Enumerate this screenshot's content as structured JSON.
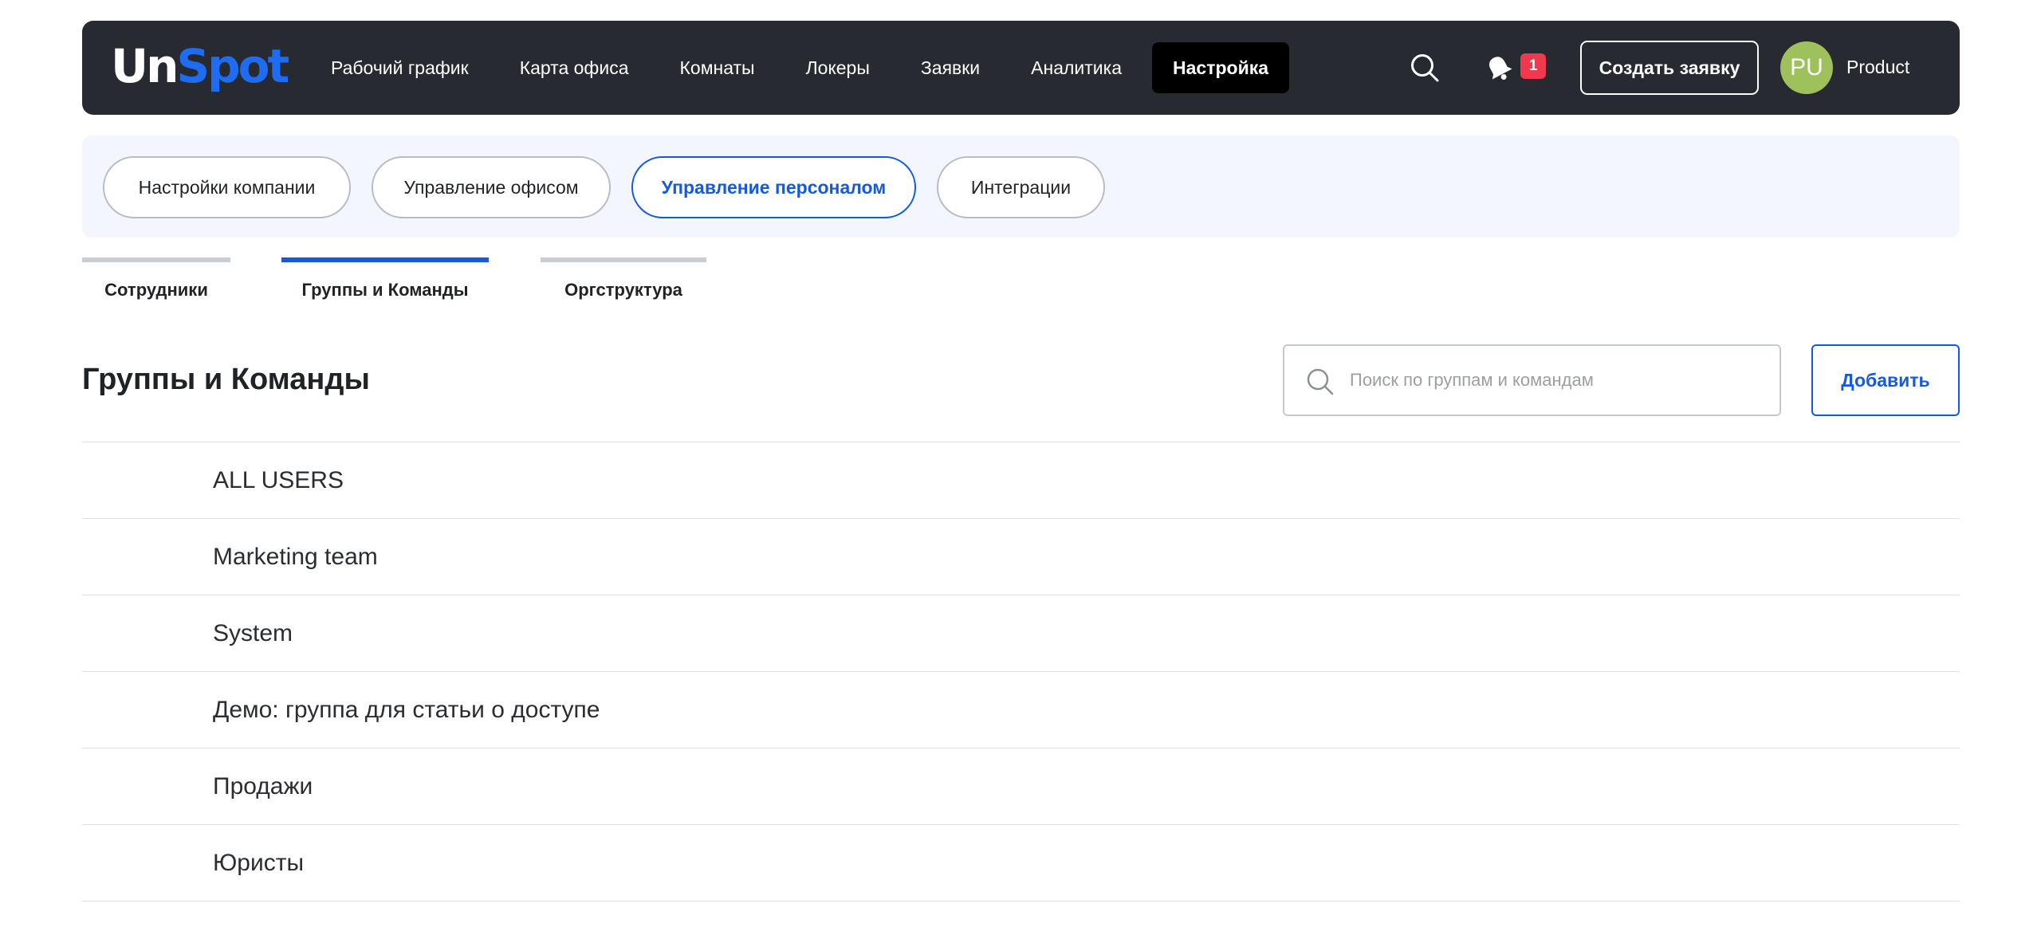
{
  "app": {
    "logo_part1": "Un",
    "logo_part2": "Spot"
  },
  "nav": {
    "items": [
      {
        "label": "Рабочий график"
      },
      {
        "label": "Карта офиса"
      },
      {
        "label": "Комнаты"
      },
      {
        "label": "Локеры"
      },
      {
        "label": "Заявки"
      },
      {
        "label": "Аналитика"
      },
      {
        "label": "Настройка",
        "active": true
      }
    ],
    "notification_count": "1",
    "create_button": "Создать заявку",
    "avatar_initials": "PU",
    "user_name": "Product"
  },
  "sections": {
    "items": [
      {
        "label": "Настройки компании"
      },
      {
        "label": "Управление офисом"
      },
      {
        "label": "Управление персоналом",
        "active": true
      },
      {
        "label": "Интеграции"
      }
    ]
  },
  "tabs": {
    "items": [
      {
        "label": "Сотрудники"
      },
      {
        "label": "Группы и Команды",
        "active": true
      },
      {
        "label": "Оргструктура"
      }
    ]
  },
  "page": {
    "title": "Группы и Команды",
    "search_placeholder": "Поиск по группам и командам",
    "search_value": "",
    "add_button": "Добавить"
  },
  "groups": [
    {
      "name": "ALL USERS"
    },
    {
      "name": "Marketing team"
    },
    {
      "name": "System"
    },
    {
      "name": "Демо: группа для статьи о доступе"
    },
    {
      "name": "Продажи"
    },
    {
      "name": "Юристы"
    }
  ],
  "colors": {
    "topbar": "#272a31",
    "accent": "#1459e3",
    "logo_accent": "#1e6cf2",
    "badge": "#f0384f",
    "avatar": "#9ec15b",
    "section_bg": "#f3f7fd"
  },
  "icons": {
    "search": "search-icon",
    "notifications": "bell-icon"
  }
}
